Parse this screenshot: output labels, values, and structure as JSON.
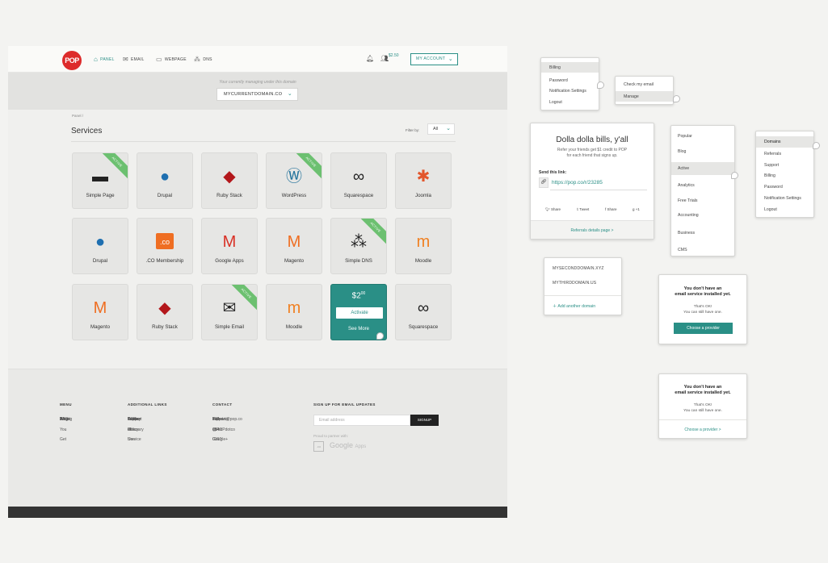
{
  "header": {
    "logo": "POP",
    "nav": [
      {
        "label": "PANEL",
        "icon": "home-icon",
        "glyph": "⌂"
      },
      {
        "label": "EMAIL",
        "icon": "envelope-icon",
        "glyph": "✉"
      },
      {
        "label": "WEBPAGE",
        "icon": "monitor-icon",
        "glyph": "▭"
      },
      {
        "label": "DNS",
        "icon": "dns-icon",
        "glyph": "⁂"
      }
    ],
    "credit": "$2.50",
    "account": "MY ACCOUNT"
  },
  "domainbar": {
    "label": "Your currently managing under this domain",
    "selected": "MYCURRENTDOMAIN.CO"
  },
  "breadcrumb": "Panel /",
  "services": {
    "title": "Services",
    "filter_label": "Filter by:",
    "filter_value": "All",
    "ribbon": "ACTIVE",
    "tiles": [
      {
        "name": "Simple Page",
        "glyph": "▬",
        "color": "#222",
        "active": true
      },
      {
        "name": "Drupal",
        "glyph": "●",
        "color": "#1e6fb0",
        "active": false
      },
      {
        "name": "Ruby Stack",
        "glyph": "◆",
        "color": "#b3171b",
        "active": false
      },
      {
        "name": "WordPress",
        "glyph": "Ⓦ",
        "color": "#22729b",
        "active": true
      },
      {
        "name": "Squarespace",
        "glyph": "∞",
        "color": "#222",
        "active": false
      },
      {
        "name": "Joomla",
        "glyph": "✱",
        "color": "#e2562c",
        "active": false
      },
      {
        "name": "Drupal",
        "glyph": "●",
        "color": "#1e6fb0",
        "active": false
      },
      {
        "name": ".CO Membership",
        "glyph": ".co",
        "color": "#ef6e22",
        "active": false
      },
      {
        "name": "Google Apps",
        "glyph": "M",
        "color": "#d93025",
        "active": false
      },
      {
        "name": "Magento",
        "glyph": "M",
        "color": "#ef6e22",
        "active": false
      },
      {
        "name": "Simple DNS",
        "glyph": "⁂",
        "color": "#222",
        "active": true
      },
      {
        "name": "Moodle",
        "glyph": "m",
        "color": "#f08022",
        "active": false
      },
      {
        "name": "Magento",
        "glyph": "M",
        "color": "#ef6e22",
        "active": false
      },
      {
        "name": "Ruby Stack",
        "glyph": "◆",
        "color": "#b3171b",
        "active": false
      },
      {
        "name": "Simple Email",
        "glyph": "✉",
        "color": "#222",
        "active": true
      },
      {
        "name": "Moodle",
        "glyph": "m",
        "color": "#f08022",
        "active": false
      },
      {
        "name": "",
        "glyph": "",
        "color": "#fff",
        "active": false,
        "promo": true
      },
      {
        "name": "Squarespace",
        "glyph": "∞",
        "color": "#222",
        "active": false
      }
    ],
    "promo": {
      "price": "$2",
      "cents": "00",
      "activate": "Activate",
      "see_more": "See More"
    }
  },
  "footer": {
    "menu_title": "MENU",
    "menu": [
      "About",
      "What You Get",
      "Pricing",
      "FAQ",
      "Blog"
    ],
    "links_title": "ADDITIONAL LINKS",
    "links": [
      "Support",
      "Guides",
      "POP Glossary",
      "Terms of Use",
      "Terms of Service",
      "Privacy Policy"
    ],
    "contact_title": "CONTACT",
    "contact": [
      "support@pop.co",
      "877-654-0367",
      "Tweet us @POPdotco",
      "Follow us on Google+"
    ],
    "signup_title": "SIGN UP FOR EMAIL UPDATES",
    "email_placeholder": "Email address",
    "signup_button": "SIGNUP",
    "partner": "Proud to partner with:",
    "co_logo": ".co",
    "google": "Google",
    "apps": "Apps"
  },
  "popups": {
    "account_menu": [
      "Billing",
      "Password",
      "Notification Settings",
      "Logout"
    ],
    "email_menu": [
      "Check my email",
      "Manage"
    ],
    "referral": {
      "title": "Dolla dolla bills, y'all",
      "text1": "Refer your friends get $1 credit to POP",
      "text2": "for each friend that signs up.",
      "send_label": "Send this link:",
      "link": "https://pop.co/r/23285",
      "shares": [
        "Share",
        "Tweet",
        "Share",
        "+1"
      ],
      "footer_link": "Referrals details page >"
    },
    "app_menu": [
      "Popular",
      "Blog",
      "Active",
      "Analytics",
      "Free Trials",
      "Accounting",
      "Business",
      "CMS"
    ],
    "settings_menu": [
      "Domains",
      "Referrals",
      "Support",
      "Billing",
      "Password",
      "Notification Settings",
      "Logout"
    ],
    "domains": [
      "MYSECONDDOMAIN.XYZ",
      "MYTHIRDDOMAIN.US"
    ],
    "add_domain": "Add another domain",
    "email_empty_1": {
      "line1": "You don't have an",
      "line2": "email service installed yet.",
      "line3": "That's OK!",
      "line4": "You can still have one.",
      "button": "Choose a provider"
    },
    "email_empty_2": {
      "line1": "You don't have an",
      "line2": "email service installed yet.",
      "line3": "That's OK!",
      "line4": "You can still have one.",
      "link": "Choose a provider >"
    }
  }
}
